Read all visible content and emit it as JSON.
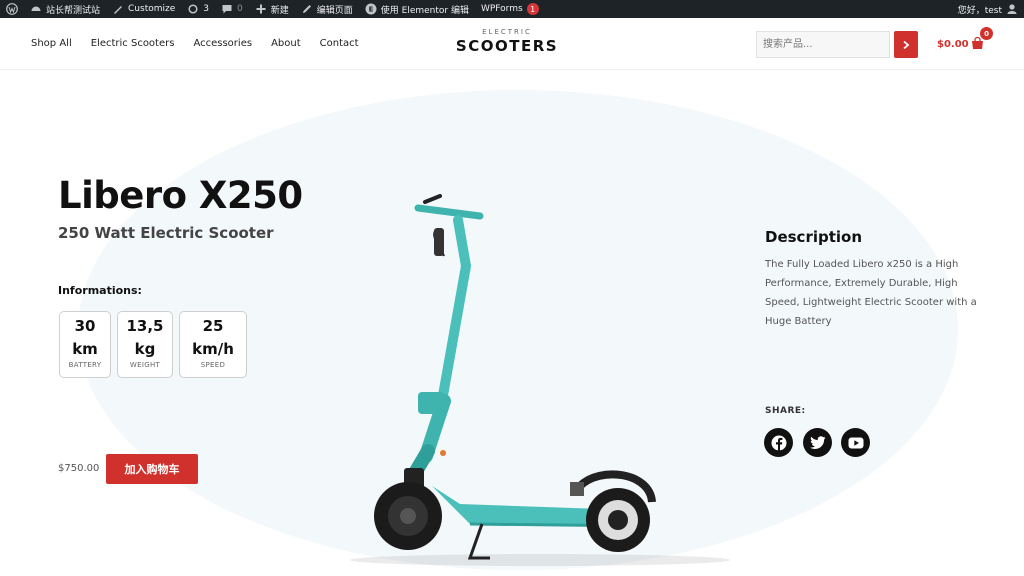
{
  "adminbar": {
    "site_name": "站长帮测试站",
    "customize": "Customize",
    "updates_count": "3",
    "comments_count": "0",
    "new_label": "新建",
    "edit_page": "编辑页面",
    "elementor_edit": "使用 Elementor 编辑",
    "wpforms": "WPForms",
    "wpforms_count": "1",
    "greeting": "您好，test"
  },
  "header": {
    "nav": [
      "Shop All",
      "Electric Scooters",
      "Accessories",
      "About",
      "Contact"
    ],
    "logo_small": "ELECTRIC",
    "logo_big": "SCOOTERS",
    "search_placeholder": "搜索产品...",
    "cart_total": "$0.00",
    "cart_count": "0"
  },
  "product": {
    "title": "Libero X250",
    "subtitle": "250 Watt Electric Scooter",
    "info_label": "Informations:",
    "specs": [
      {
        "value": "30",
        "unit": "km",
        "label": "BATTERY"
      },
      {
        "value": "13,5",
        "unit": "kg",
        "label": "WEIGHT"
      },
      {
        "value": "25",
        "unit": "km/h",
        "label": "SPEED"
      }
    ],
    "price": "$750.00",
    "add_to_cart": "加入购物车"
  },
  "description": {
    "title": "Description",
    "text": "The Fully Loaded Libero x250 is a High Performance, Extremely Durable, High Speed, Lightweight Electric Scooter with a Huge Battery",
    "share_label": "SHARE:"
  },
  "colors": {
    "accent": "#d0312d",
    "adminbar": "#1d2327",
    "scooter_teal": "#4bbfba",
    "bg_circle": "#f3f8fa"
  },
  "social_icons": [
    "facebook-icon",
    "twitter-icon",
    "youtube-icon"
  ]
}
